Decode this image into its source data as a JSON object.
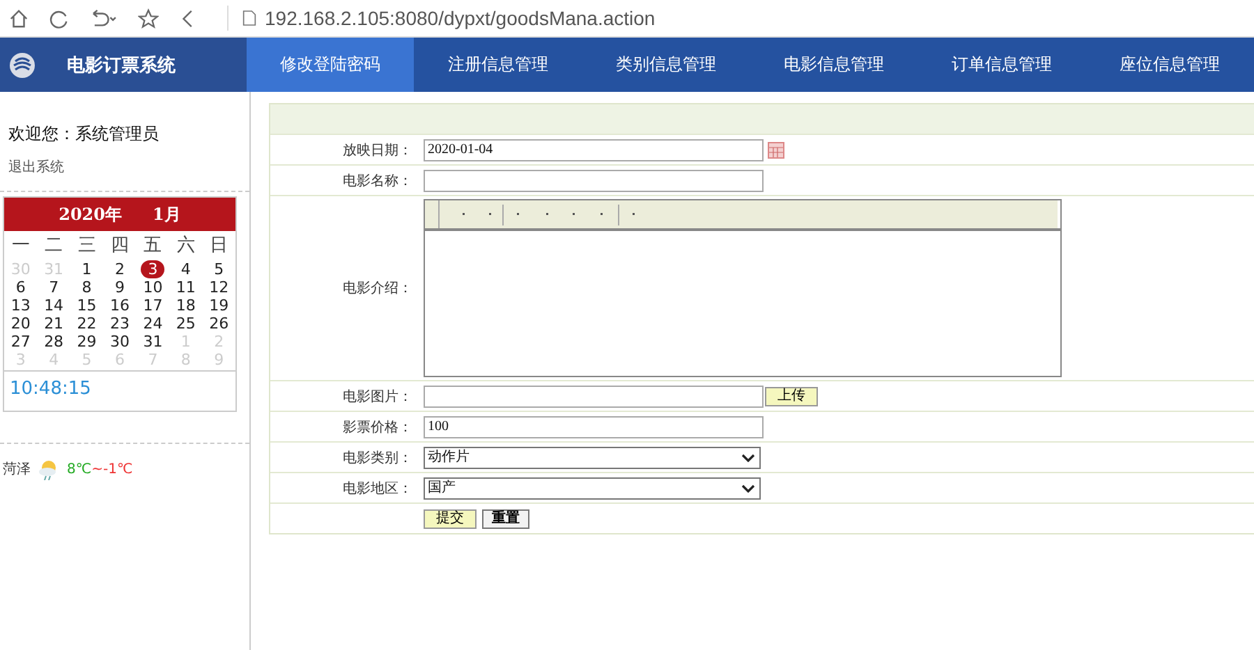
{
  "browser": {
    "url": "192.168.2.105:8080/dypxt/goodsMana.action"
  },
  "header": {
    "logo_text": "电影订票系统",
    "nav": [
      {
        "label": "修改登陆密码",
        "selected": true
      },
      {
        "label": "注册信息管理",
        "selected": false
      },
      {
        "label": "类别信息管理",
        "selected": false
      },
      {
        "label": "电影信息管理",
        "selected": false
      },
      {
        "label": "订单信息管理",
        "selected": false
      },
      {
        "label": "座位信息管理",
        "selected": false
      }
    ]
  },
  "sidebar": {
    "welcome": "欢迎您：系统管理员",
    "logout": "退出系统",
    "calendar": {
      "year": "2020年",
      "month": "1月",
      "weekdays": [
        "一",
        "二",
        "三",
        "四",
        "五",
        "六",
        "日"
      ],
      "days": [
        {
          "label": "30",
          "muted": true,
          "selected": false
        },
        {
          "label": "31",
          "muted": true,
          "selected": false
        },
        {
          "label": "1",
          "muted": false,
          "selected": false
        },
        {
          "label": "2",
          "muted": false,
          "selected": false
        },
        {
          "label": "3",
          "muted": false,
          "selected": true
        },
        {
          "label": "4",
          "muted": false,
          "selected": false
        },
        {
          "label": "5",
          "muted": false,
          "selected": false
        },
        {
          "label": "6",
          "muted": false,
          "selected": false
        },
        {
          "label": "7",
          "muted": false,
          "selected": false
        },
        {
          "label": "8",
          "muted": false,
          "selected": false
        },
        {
          "label": "9",
          "muted": false,
          "selected": false
        },
        {
          "label": "10",
          "muted": false,
          "selected": false
        },
        {
          "label": "11",
          "muted": false,
          "selected": false
        },
        {
          "label": "12",
          "muted": false,
          "selected": false
        },
        {
          "label": "13",
          "muted": false,
          "selected": false
        },
        {
          "label": "14",
          "muted": false,
          "selected": false
        },
        {
          "label": "15",
          "muted": false,
          "selected": false
        },
        {
          "label": "16",
          "muted": false,
          "selected": false
        },
        {
          "label": "17",
          "muted": false,
          "selected": false
        },
        {
          "label": "18",
          "muted": false,
          "selected": false
        },
        {
          "label": "19",
          "muted": false,
          "selected": false
        },
        {
          "label": "20",
          "muted": false,
          "selected": false
        },
        {
          "label": "21",
          "muted": false,
          "selected": false
        },
        {
          "label": "22",
          "muted": false,
          "selected": false
        },
        {
          "label": "23",
          "muted": false,
          "selected": false
        },
        {
          "label": "24",
          "muted": false,
          "selected": false
        },
        {
          "label": "25",
          "muted": false,
          "selected": false
        },
        {
          "label": "26",
          "muted": false,
          "selected": false
        },
        {
          "label": "27",
          "muted": false,
          "selected": false
        },
        {
          "label": "28",
          "muted": false,
          "selected": false
        },
        {
          "label": "29",
          "muted": false,
          "selected": false
        },
        {
          "label": "30",
          "muted": false,
          "selected": false
        },
        {
          "label": "31",
          "muted": false,
          "selected": false
        },
        {
          "label": "1",
          "muted": true,
          "selected": false
        },
        {
          "label": "2",
          "muted": true,
          "selected": false
        },
        {
          "label": "3",
          "muted": true,
          "selected": false
        },
        {
          "label": "4",
          "muted": true,
          "selected": false
        },
        {
          "label": "5",
          "muted": true,
          "selected": false
        },
        {
          "label": "6",
          "muted": true,
          "selected": false
        },
        {
          "label": "7",
          "muted": true,
          "selected": false
        },
        {
          "label": "8",
          "muted": true,
          "selected": false
        },
        {
          "label": "9",
          "muted": true,
          "selected": false
        }
      ]
    },
    "clock": "10:48:15",
    "weather": {
      "city": "菏泽",
      "high": "8℃",
      "low": "~-1℃"
    }
  },
  "form": {
    "fields": [
      {
        "kind": "date",
        "label": "放映日期：",
        "value": "2020-01-04"
      },
      {
        "kind": "text",
        "label": "电影名称："
      },
      {
        "kind": "editor",
        "label": "电影介绍："
      },
      {
        "kind": "file",
        "label": "电影图片：",
        "button": "上传"
      },
      {
        "kind": "text",
        "label": "影票价格：",
        "value": "100"
      },
      {
        "kind": "select",
        "label": "电影类别：",
        "value": "动作片"
      },
      {
        "kind": "select",
        "label": "电影地区：",
        "value": "国产"
      }
    ],
    "buttons": [
      "提交",
      "重置"
    ]
  }
}
